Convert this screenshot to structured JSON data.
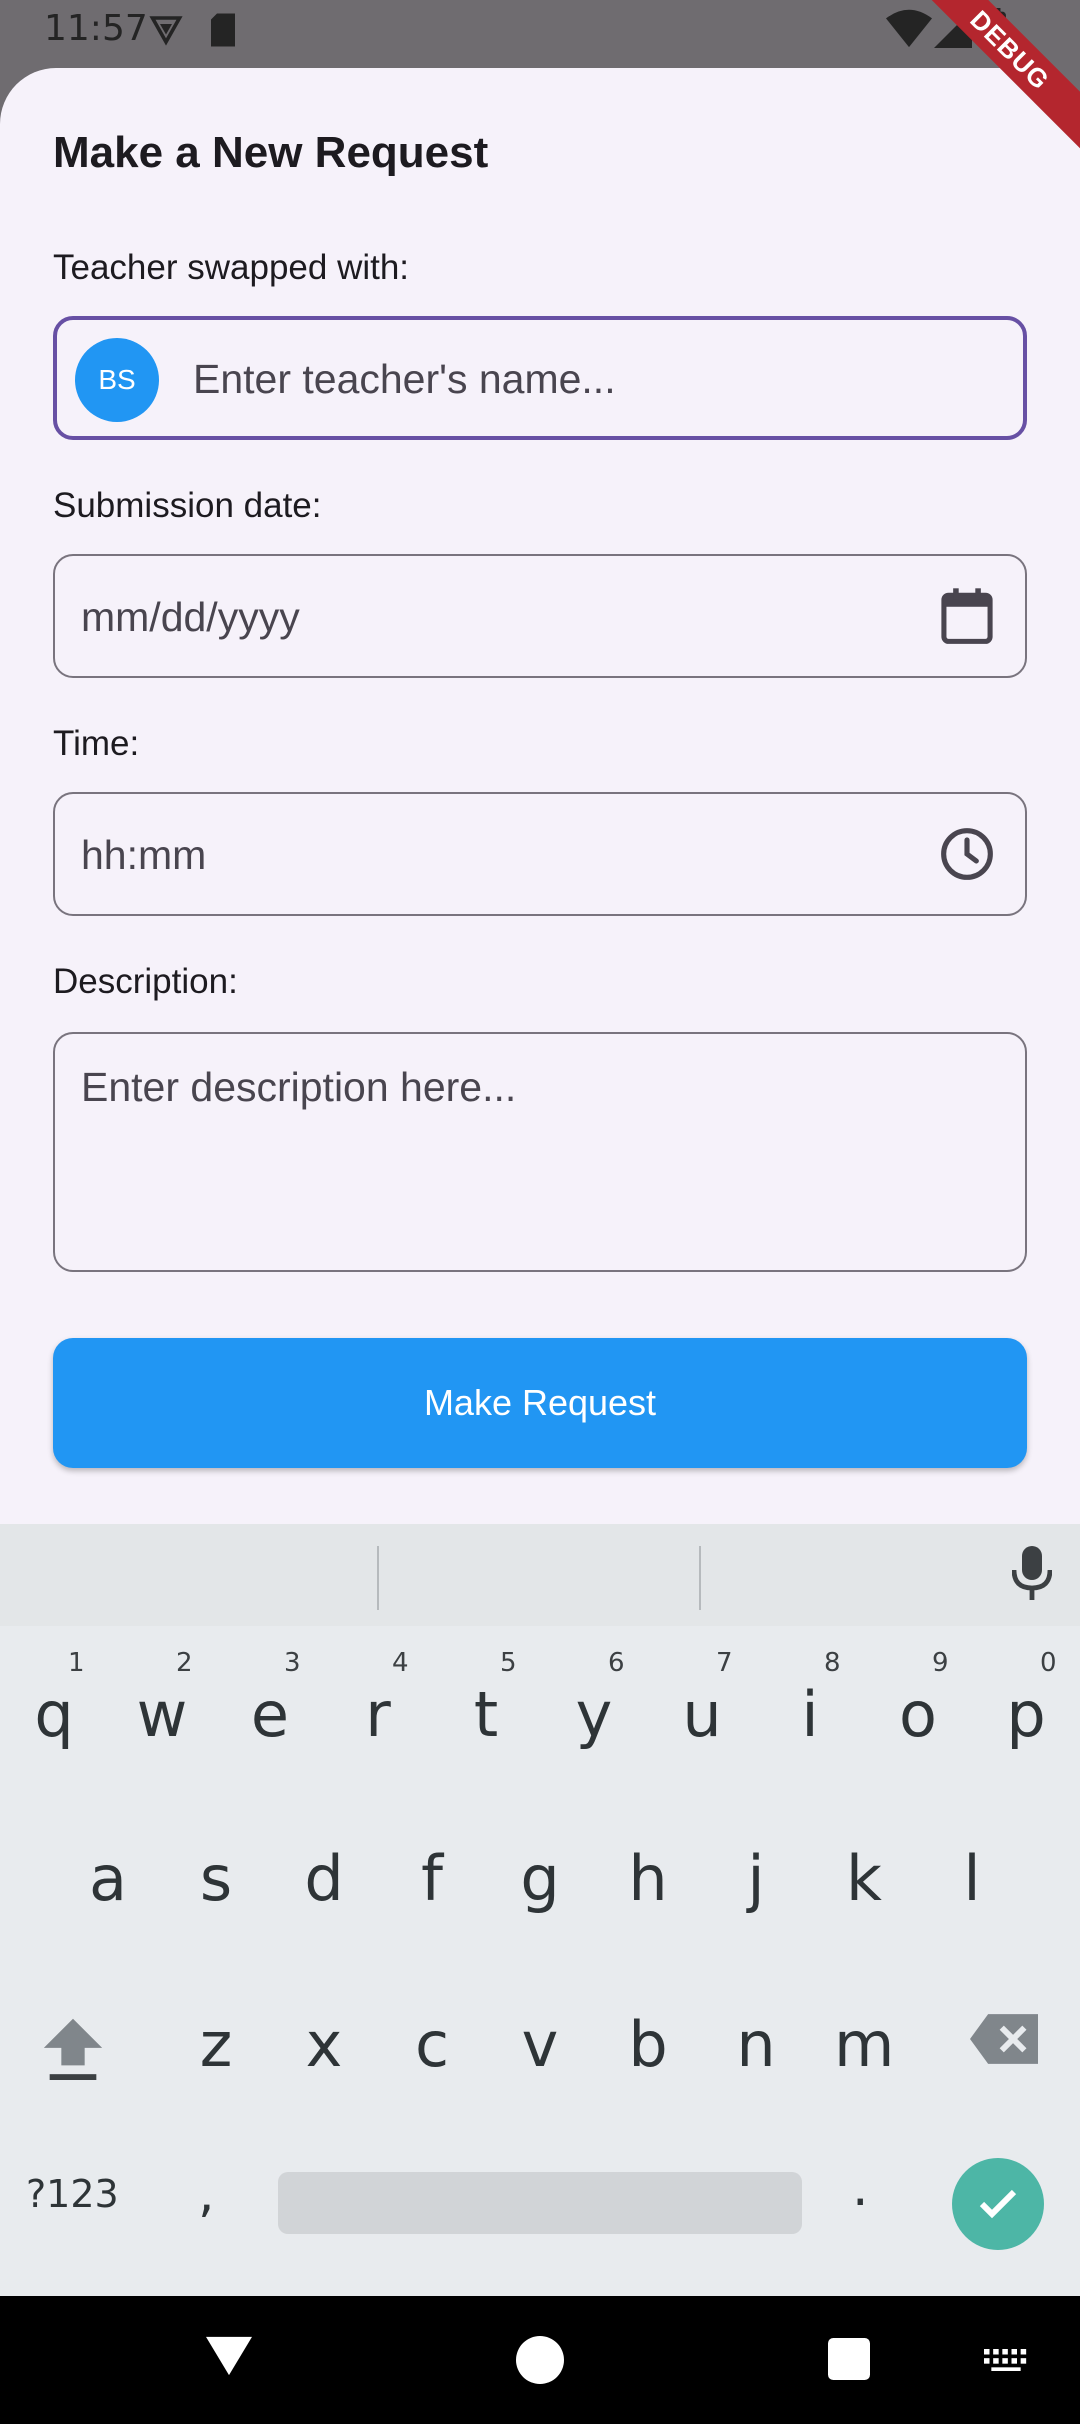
{
  "status_bar": {
    "time": "11:57",
    "icons": [
      "vpn-shield-icon",
      "sd-card-icon",
      "wifi-icon",
      "cell-signal-icon",
      "battery-icon"
    ]
  },
  "debug_banner": "DEBUG",
  "form": {
    "title": "Make a New Request",
    "teacher_label": "Teacher swapped with:",
    "teacher_avatar": "BS",
    "teacher_placeholder": "Enter teacher's name...",
    "date_label": "Submission date:",
    "date_placeholder": "mm/dd/yyyy",
    "time_label": "Time:",
    "time_placeholder": "hh:mm",
    "description_label": "Description:",
    "description_placeholder": "Enter description here...",
    "submit_label": "Make Request"
  },
  "colors": {
    "accent": "#2196f3",
    "focus_border": "#6750a4",
    "sheet_bg": "#f6f2fa",
    "enter_key": "#4db6a6"
  },
  "keyboard": {
    "row1": [
      "q",
      "w",
      "e",
      "r",
      "t",
      "y",
      "u",
      "i",
      "o",
      "p"
    ],
    "row1_hints": [
      "1",
      "2",
      "3",
      "4",
      "5",
      "6",
      "7",
      "8",
      "9",
      "0"
    ],
    "row2": [
      "a",
      "s",
      "d",
      "f",
      "g",
      "h",
      "j",
      "k",
      "l"
    ],
    "row3": [
      "z",
      "x",
      "c",
      "v",
      "b",
      "n",
      "m"
    ],
    "symbols_label": "?123",
    "comma": ",",
    "period": "."
  }
}
